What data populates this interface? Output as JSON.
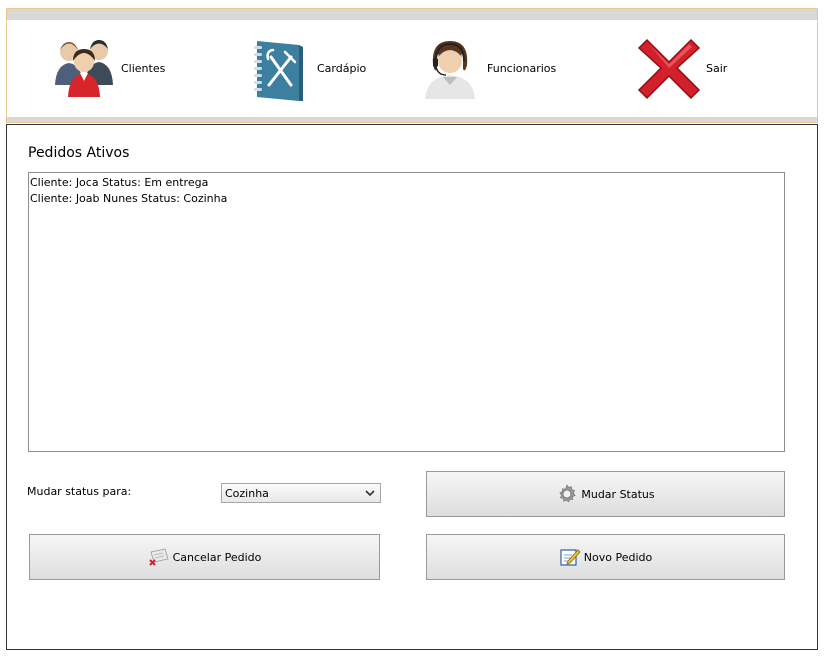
{
  "toolbar": {
    "items": [
      {
        "label": "Clientes",
        "icon": "users-group-icon"
      },
      {
        "label": "Cardápio",
        "icon": "menu-book-icon"
      },
      {
        "label": "Funcionarios",
        "icon": "employee-headset-icon"
      },
      {
        "label": "Sair",
        "icon": "exit-x-icon"
      }
    ]
  },
  "panel": {
    "title": "Pedidos Ativos",
    "orders": [
      "Cliente: Joca Status: Em entrega",
      "Cliente: Joab Nunes Status: Cozinha"
    ],
    "status_label": "Mudar status para:",
    "status_selected": "Cozinha",
    "buttons": {
      "mudar_status": "Mudar Status",
      "cancelar_pedido": "Cancelar Pedido",
      "novo_pedido": "Novo Pedido"
    }
  },
  "colors": {
    "toolbar_border": "#e9c98f",
    "strip": "#d8d8d8",
    "menu_book": "#3d7f9e",
    "exit_red": "#d3202a"
  }
}
